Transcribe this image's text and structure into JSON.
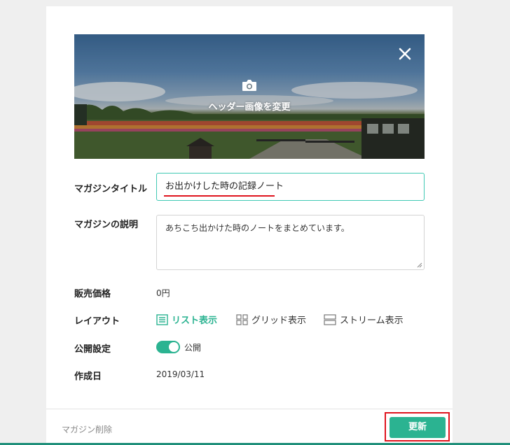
{
  "header_image": {
    "change_label": "ヘッダー画像を変更",
    "camera_icon": "camera-icon",
    "close_icon": "close-icon"
  },
  "form": {
    "title_label": "マガジンタイトル",
    "title_value": "お出かけした時の記録ノート",
    "description_label": "マガジンの説明",
    "description_value": "あちこち出かけた時のノートをまとめています。",
    "price_label": "販売価格",
    "price_value": "0円",
    "layout_label": "レイアウト",
    "layout_options": [
      {
        "label": "リスト表示",
        "icon": "list-icon",
        "selected": true
      },
      {
        "label": "グリッド表示",
        "icon": "grid-icon",
        "selected": false
      },
      {
        "label": "ストリーム表示",
        "icon": "stream-icon",
        "selected": false
      }
    ],
    "visibility_label": "公開設定",
    "visibility_value": "公開",
    "visibility_on": true,
    "created_label": "作成日",
    "created_value": "2019/03/11"
  },
  "footer": {
    "delete_label": "マガジン削除",
    "update_label": "更新"
  },
  "colors": {
    "accent": "#2bb391",
    "input_focus": "#41c9b4",
    "highlight": "#e0141e"
  }
}
